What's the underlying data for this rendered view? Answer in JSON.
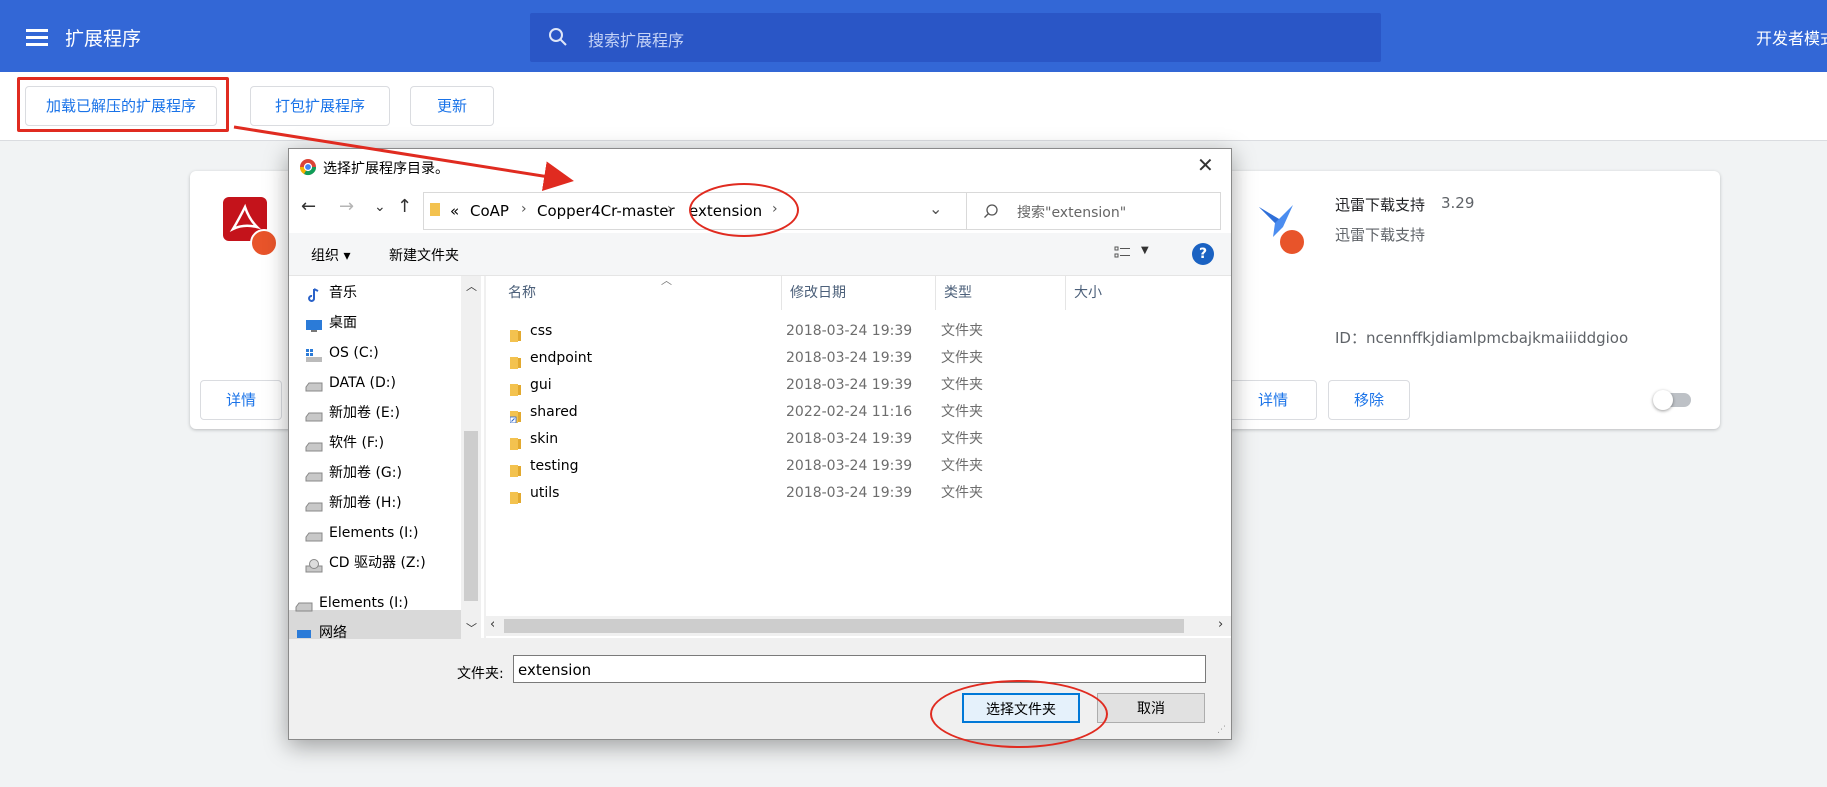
{
  "header": {
    "title": "扩展程序",
    "search_placeholder": "搜索扩展程序",
    "dev_mode_label": "开发者模式"
  },
  "toolbar": {
    "load_unpacked": "加载已解压的扩展程序",
    "pack": "打包扩展程序",
    "update": "更新"
  },
  "cards": {
    "left": {
      "details": "详情"
    },
    "right": {
      "name": "迅雷下载支持",
      "version": "3.29",
      "description": "迅雷下载支持",
      "id": "ID：ncennffkjdiamlpmcbajkmaiiiddgioo",
      "details": "详情",
      "remove": "移除"
    }
  },
  "dialog": {
    "title": "选择扩展程序目录。",
    "close": "✕",
    "nav": {
      "back": "←",
      "forward": "→",
      "recent": "⌄",
      "up": "↑"
    },
    "breadcrumb": [
      "«",
      "CoAP",
      "Copper4Cr-master",
      "extension"
    ],
    "refresh": "↻",
    "search_placeholder": "搜索\"extension\"",
    "commands": {
      "organize": "组织 ▾",
      "new_folder": "新建文件夹",
      "help": "?"
    },
    "nav_pane": [
      {
        "label": "音乐",
        "icon": "music-icon"
      },
      {
        "label": "桌面",
        "icon": "desktop-icon"
      },
      {
        "label": "OS (C:)",
        "icon": "windows-drive-icon"
      },
      {
        "label": "DATA (D:)",
        "icon": "drive-icon"
      },
      {
        "label": "新加卷 (E:)",
        "icon": "drive-icon"
      },
      {
        "label": "软件 (F:)",
        "icon": "drive-icon"
      },
      {
        "label": "新加卷 (G:)",
        "icon": "drive-icon"
      },
      {
        "label": "新加卷 (H:)",
        "icon": "drive-icon",
        "selected": true
      },
      {
        "label": "Elements (I:)",
        "icon": "drive-icon"
      },
      {
        "label": "CD 驱动器 (Z:)",
        "icon": "cd-drive-icon"
      },
      {
        "label": "Elements (I:)",
        "icon": "drive-icon"
      },
      {
        "label": "网络",
        "icon": "network-icon"
      }
    ],
    "columns": [
      "名称",
      "修改日期",
      "类型",
      "大小"
    ],
    "files": [
      {
        "name": "css",
        "date": "2018-03-24 19:39",
        "type": "文件夹",
        "icon": "folder-icon"
      },
      {
        "name": "endpoint",
        "date": "2018-03-24 19:39",
        "type": "文件夹",
        "icon": "folder-icon"
      },
      {
        "name": "gui",
        "date": "2018-03-24 19:39",
        "type": "文件夹",
        "icon": "folder-icon"
      },
      {
        "name": "shared",
        "date": "2022-02-24 11:16",
        "type": "文件夹",
        "icon": "folder-shortcut-icon"
      },
      {
        "name": "skin",
        "date": "2018-03-24 19:39",
        "type": "文件夹",
        "icon": "folder-icon"
      },
      {
        "name": "testing",
        "date": "2018-03-24 19:39",
        "type": "文件夹",
        "icon": "folder-icon"
      },
      {
        "name": "utils",
        "date": "2018-03-24 19:39",
        "type": "文件夹",
        "icon": "folder-icon"
      }
    ],
    "folder_label": "文件夹:",
    "folder_value": "extension",
    "select_button": "选择文件夹",
    "cancel_button": "取消"
  },
  "colors": {
    "header_bg": "#3367d6",
    "accent": "#1a73e8",
    "annotation_red": "#e02b20"
  }
}
